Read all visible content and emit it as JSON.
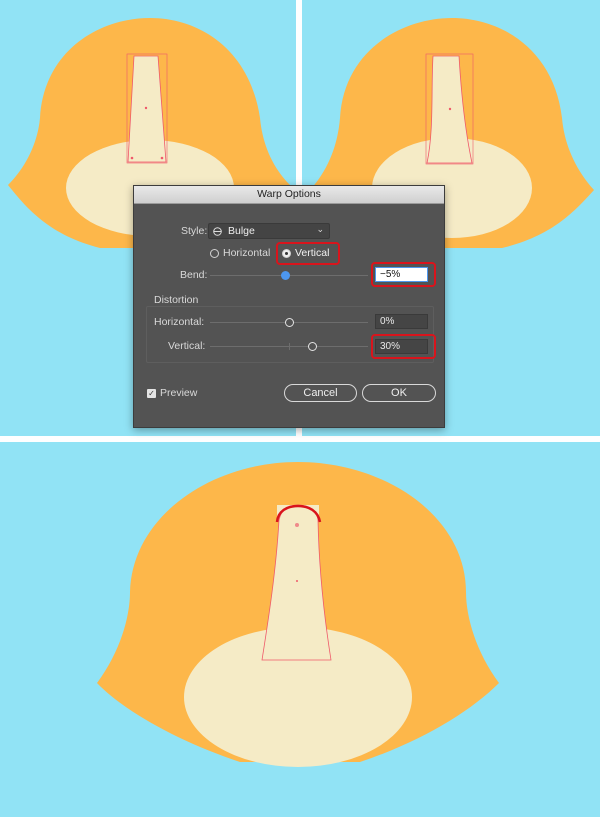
{
  "dialog": {
    "title": "Warp Options",
    "style_label": "Style:",
    "style_value": "Bulge",
    "orientation": {
      "horizontal_label": "Horizontal",
      "vertical_label": "Vertical",
      "selected": "Vertical"
    },
    "bend_label": "Bend:",
    "bend_value": "−5%",
    "bend_fraction": 0.475,
    "distortion_section_label": "Distortion",
    "distortion_horizontal_label": "Horizontal:",
    "distortion_horizontal_value": "0%",
    "distortion_horizontal_fraction": 0.5,
    "distortion_vertical_label": "Vertical:",
    "distortion_vertical_value": "30%",
    "distortion_vertical_fraction": 0.65,
    "preview_label": "Preview",
    "preview_checked": true,
    "cancel_label": "Cancel",
    "ok_label": "OK"
  },
  "colors": {
    "background": "#91e3f5",
    "hair": "#fdb74a",
    "face": "#f5ebc6",
    "selection": "#ef5a6a",
    "highlight": "#d9141c",
    "accent": "#4d97ef"
  },
  "icons": {
    "style_icon": "bulge-icon",
    "dropdown_icon": "chevron-down-icon",
    "check_icon": "checkmark-icon"
  }
}
